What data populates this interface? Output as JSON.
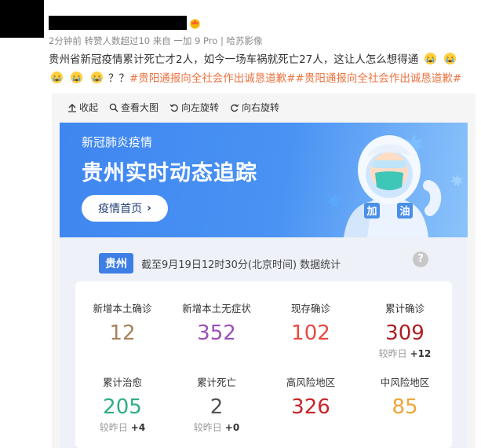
{
  "post": {
    "meta": "2分钟前 转赞人数超过10  来自 一加 9 Pro | 哈苏影像",
    "text": "贵州省新冠疫情累计死亡才2人，如今一场车祸就死亡27人，这让人怎么想得通",
    "punct": "？？",
    "hashtags": "#贵阳通报向全社会作出诚恳道歉##贵阳通报向全社会作出诚恳道歉#"
  },
  "toolbar": {
    "collapse": "收起",
    "view_large": "查看大图",
    "rotate_left": "向左旋转",
    "rotate_right": "向右旋转"
  },
  "banner": {
    "subtitle": "新冠肺炎疫情",
    "title": "贵州实时动态追踪",
    "home_button": "疫情首页",
    "figure_text": "加 油"
  },
  "region": {
    "name": "贵州",
    "stat_time": "截至9月19日12时30分(北京时间)  数据统计"
  },
  "stats": [
    {
      "label": "新增本土确诊",
      "value": "12",
      "color": "#a6825d",
      "delta_label": "",
      "delta": ""
    },
    {
      "label": "新增本土无症状",
      "value": "352",
      "color": "#9c4fb8",
      "delta_label": "",
      "delta": ""
    },
    {
      "label": "现存确诊",
      "value": "102",
      "color": "#e84a3f",
      "delta_label": "",
      "delta": ""
    },
    {
      "label": "累计确诊",
      "value": "309",
      "color": "#b01e23",
      "delta_label": "较昨日",
      "delta": "+12"
    },
    {
      "label": "累计治愈",
      "value": "205",
      "color": "#2fae84",
      "delta_label": "较昨日",
      "delta": "+4"
    },
    {
      "label": "累计死亡",
      "value": "2",
      "color": "#555555",
      "delta_label": "较昨日",
      "delta": "+0"
    },
    {
      "label": "高风险地区",
      "value": "326",
      "color": "#c8262b",
      "delta_label": "",
      "delta": ""
    },
    {
      "label": "中风险地区",
      "value": "85",
      "color": "#eea63a",
      "delta_label": "",
      "delta": ""
    }
  ]
}
